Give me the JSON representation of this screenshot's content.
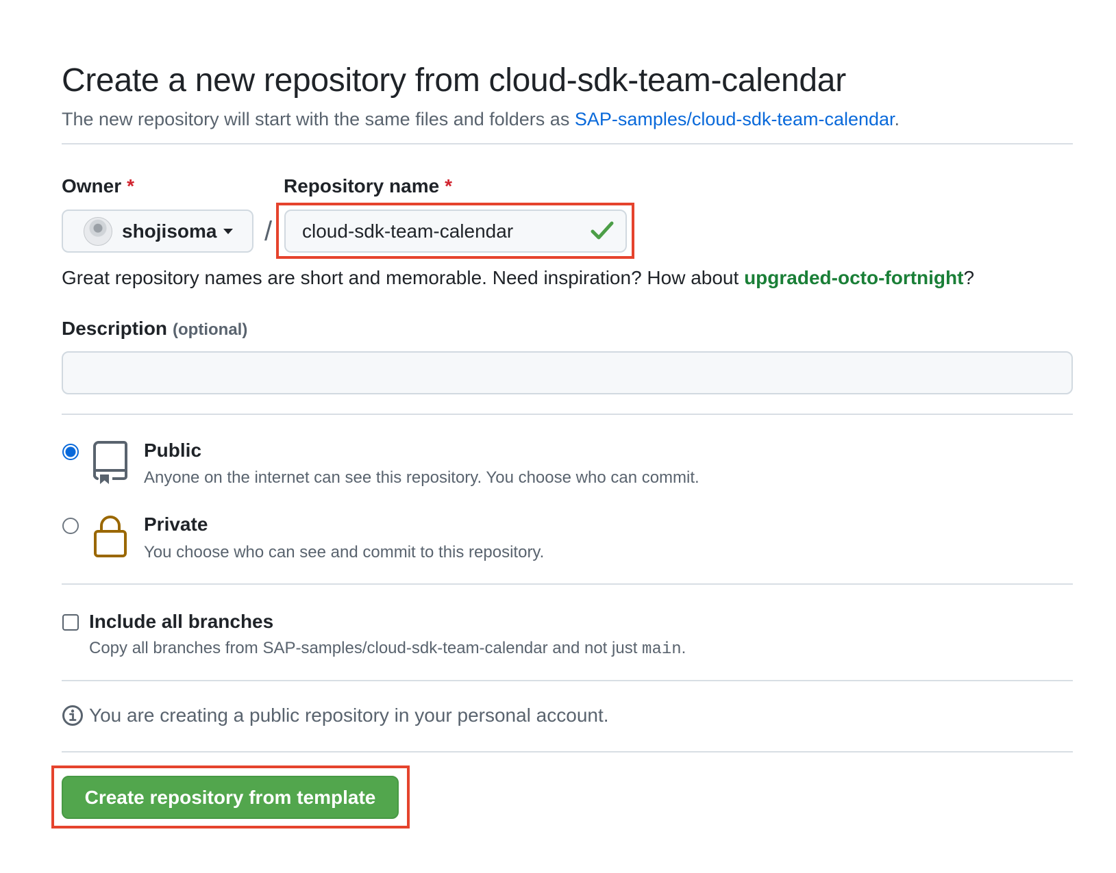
{
  "header": {
    "title": "Create a new repository from cloud-sdk-team-calendar",
    "subtitle_prefix": "The new repository will start with the same files and folders as ",
    "template_link": "SAP-samples/cloud-sdk-team-calendar",
    "subtitle_suffix": "."
  },
  "owner": {
    "label": "Owner",
    "required_mark": "*",
    "value": "shojisoma"
  },
  "separator": "/",
  "repository_name": {
    "label": "Repository name",
    "required_mark": "*",
    "value": "cloud-sdk-team-calendar",
    "status": "valid"
  },
  "name_hint": {
    "prefix": "Great repository names are short and memorable. Need inspiration? How about ",
    "suggestion": "upgraded-octo-fortnight",
    "suffix": "?"
  },
  "description": {
    "label": "Description",
    "optional": "(optional)",
    "value": ""
  },
  "visibility": {
    "selected": "public",
    "options": [
      {
        "id": "public",
        "title": "Public",
        "description": "Anyone on the internet can see this repository. You choose who can commit.",
        "icon": "repo-icon"
      },
      {
        "id": "private",
        "title": "Private",
        "description": "You choose who can see and commit to this repository.",
        "icon": "lock-icon"
      }
    ]
  },
  "include_branches": {
    "label": "Include all branches",
    "checked": false,
    "desc_prefix": "Copy all branches from SAP-samples/cloud-sdk-team-calendar and not just ",
    "branch": "main",
    "desc_suffix": "."
  },
  "info": {
    "text": "You are creating a public repository in your personal account.",
    "icon": "info-icon"
  },
  "submit": {
    "label": "Create repository from template"
  },
  "colors": {
    "link": "#0969da",
    "suggestion": "#1a7f37",
    "required": "#d1242f",
    "button": "#52a64d",
    "highlight": "#e5432d",
    "lock": "#9a6700"
  }
}
